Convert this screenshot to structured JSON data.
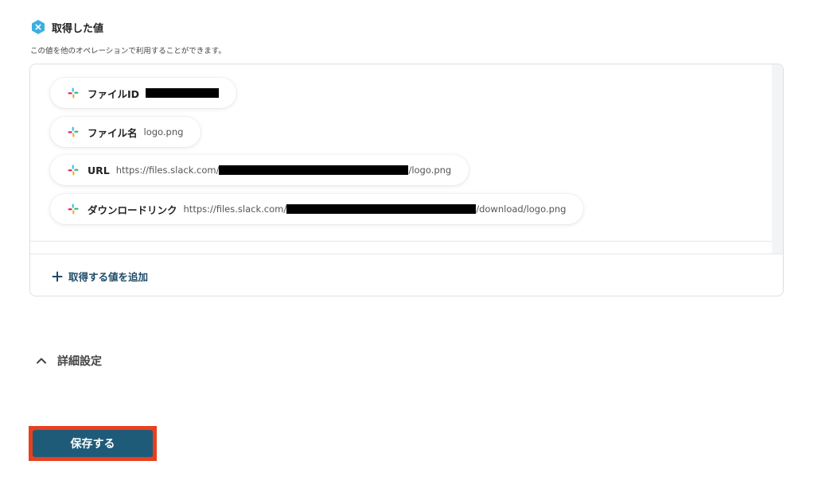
{
  "section": {
    "title": "取得した値",
    "description": "この値を他のオペレーションで利用することができます。",
    "icon": "hex-x-icon",
    "icon_color": "#3bb0e0"
  },
  "values": [
    {
      "label": "ファイルID",
      "value": ""
    },
    {
      "label": "ファイル名",
      "value": "logo.png"
    },
    {
      "label": "URL",
      "value_prefix": "https://files.slack.com/",
      "value_suffix": "/logo.png"
    },
    {
      "label": "ダウンロードリンク",
      "value_prefix": "https://files.slack.com/",
      "value_suffix": "/download/logo.png"
    }
  ],
  "add_value": {
    "label": "取得する値を追加",
    "icon": "plus-icon"
  },
  "advanced": {
    "label": "詳細設定",
    "icon": "chevron-up-icon"
  },
  "save_button": {
    "label": "保存する"
  },
  "colors": {
    "accent": "#1e5b78",
    "highlight_border": "#e8401f",
    "link": "#1e4b67"
  }
}
